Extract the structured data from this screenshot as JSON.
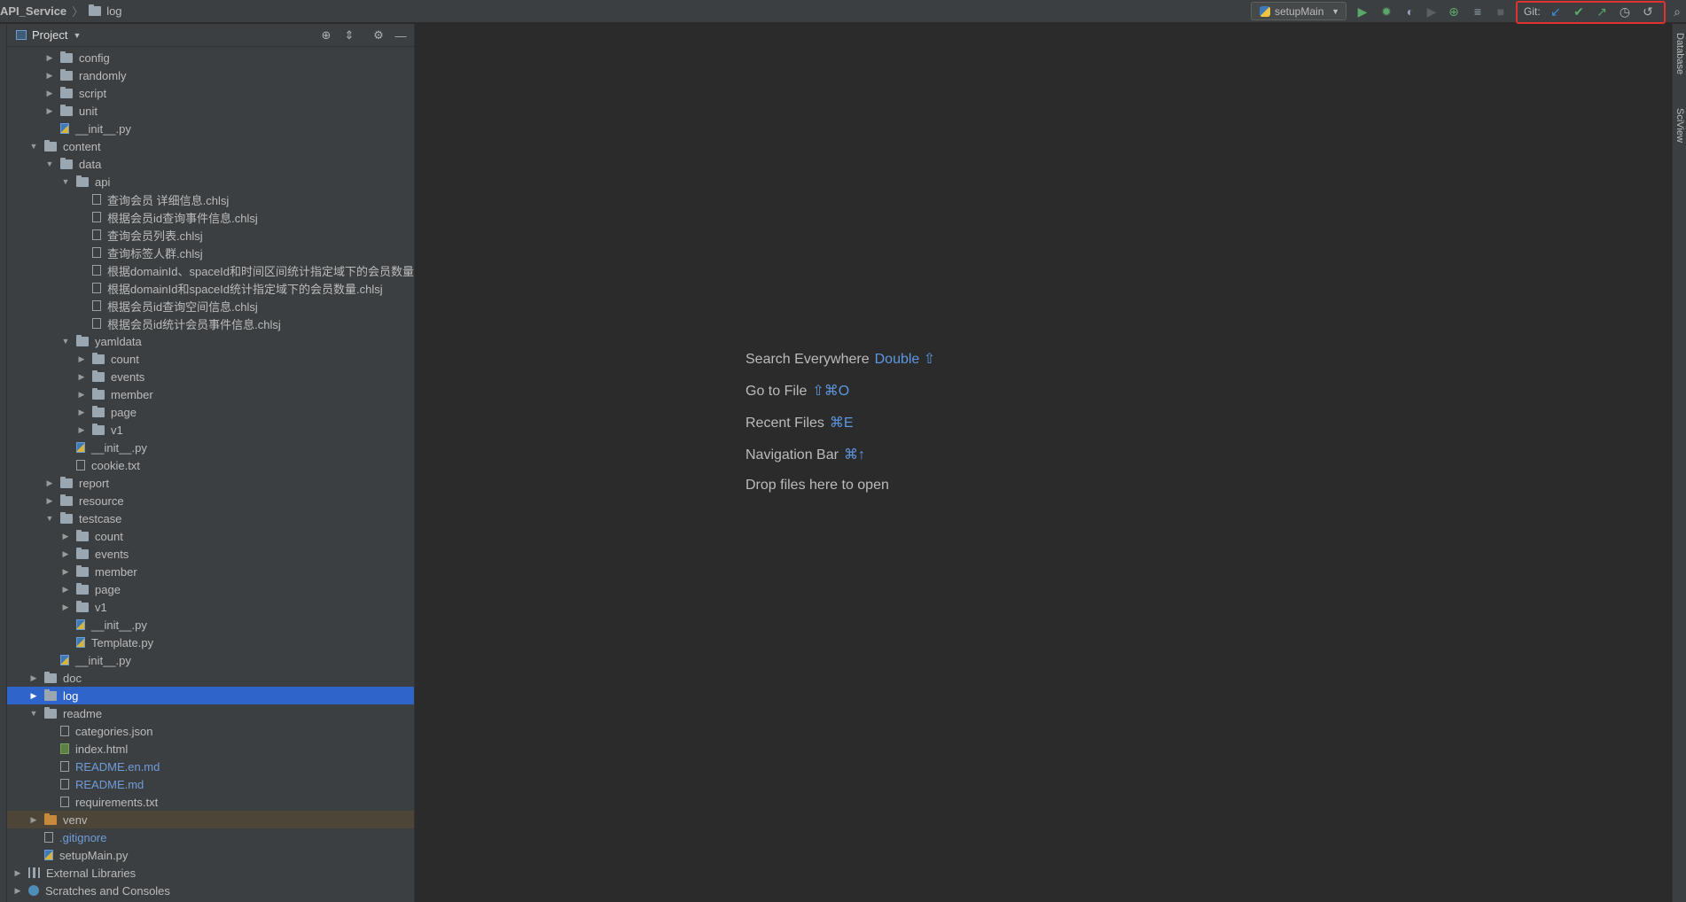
{
  "breadcrumb": {
    "project": "API_Service",
    "folder": "log"
  },
  "toolbar": {
    "run_config": "setupMain",
    "git_label": "Git:",
    "icons": [
      "run-icon",
      "debug-icon",
      "coverage-icon",
      "profile-icon",
      "attach-icon",
      "build-icon",
      "stop-icon"
    ],
    "git_icons": [
      "git-update-icon",
      "git-commit-icon",
      "git-push-icon",
      "git-history-icon",
      "git-rollback-icon"
    ],
    "search_icon": "search-icon"
  },
  "project_panel": {
    "title": "Project"
  },
  "tree": [
    {
      "depth": 2,
      "type": "folder",
      "expanded": false,
      "label": "config"
    },
    {
      "depth": 2,
      "type": "folder",
      "expanded": false,
      "label": "randomly"
    },
    {
      "depth": 2,
      "type": "folder",
      "expanded": false,
      "label": "script"
    },
    {
      "depth": 2,
      "type": "folder",
      "expanded": false,
      "label": "unit"
    },
    {
      "depth": 2,
      "type": "py",
      "label": "__init__.py"
    },
    {
      "depth": 1,
      "type": "folder",
      "expanded": true,
      "label": "content"
    },
    {
      "depth": 2,
      "type": "folder",
      "expanded": true,
      "label": "data"
    },
    {
      "depth": 3,
      "type": "folder",
      "expanded": true,
      "label": "api"
    },
    {
      "depth": 4,
      "type": "file",
      "label": " 查询会员 详细信息.chlsj"
    },
    {
      "depth": 4,
      "type": "file",
      "label": " 根据会员id查询事件信息.chlsj"
    },
    {
      "depth": 4,
      "type": "file",
      "label": "查询会员列表.chlsj"
    },
    {
      "depth": 4,
      "type": "file",
      "label": "查询标签人群.chlsj"
    },
    {
      "depth": 4,
      "type": "file",
      "label": "根据domainId、spaceId和时间区间统计指定域下的会员数量"
    },
    {
      "depth": 4,
      "type": "file",
      "label": "根据domainId和spaceId统计指定域下的会员数量.chlsj"
    },
    {
      "depth": 4,
      "type": "file",
      "label": "根据会员id查询空间信息.chlsj"
    },
    {
      "depth": 4,
      "type": "file",
      "label": "根据会员id统计会员事件信息.chlsj"
    },
    {
      "depth": 3,
      "type": "folder",
      "expanded": true,
      "label": "yamldata"
    },
    {
      "depth": 4,
      "type": "folder",
      "expanded": false,
      "label": "count"
    },
    {
      "depth": 4,
      "type": "folder",
      "expanded": false,
      "label": "events"
    },
    {
      "depth": 4,
      "type": "folder",
      "expanded": false,
      "label": "member"
    },
    {
      "depth": 4,
      "type": "folder",
      "expanded": false,
      "label": "page"
    },
    {
      "depth": 4,
      "type": "folder",
      "expanded": false,
      "label": "v1"
    },
    {
      "depth": 3,
      "type": "py",
      "label": "__init__.py"
    },
    {
      "depth": 3,
      "type": "file",
      "label": "cookie.txt"
    },
    {
      "depth": 2,
      "type": "folder",
      "expanded": false,
      "label": "report"
    },
    {
      "depth": 2,
      "type": "folder",
      "expanded": false,
      "label": "resource"
    },
    {
      "depth": 2,
      "type": "folder",
      "expanded": true,
      "label": "testcase"
    },
    {
      "depth": 3,
      "type": "folder",
      "expanded": false,
      "label": "count"
    },
    {
      "depth": 3,
      "type": "folder",
      "expanded": false,
      "label": "events"
    },
    {
      "depth": 3,
      "type": "folder",
      "expanded": false,
      "label": "member"
    },
    {
      "depth": 3,
      "type": "folder",
      "expanded": false,
      "label": "page"
    },
    {
      "depth": 3,
      "type": "folder",
      "expanded": false,
      "label": "v1"
    },
    {
      "depth": 3,
      "type": "py",
      "label": "__init__.py"
    },
    {
      "depth": 3,
      "type": "py",
      "label": "Template.py"
    },
    {
      "depth": 2,
      "type": "py",
      "label": "__init__.py"
    },
    {
      "depth": 1,
      "type": "folder",
      "expanded": false,
      "label": "doc"
    },
    {
      "depth": 1,
      "type": "folder",
      "expanded": false,
      "label": "log",
      "selected": true
    },
    {
      "depth": 1,
      "type": "folder",
      "expanded": true,
      "label": "readme"
    },
    {
      "depth": 2,
      "type": "json",
      "label": "categories.json"
    },
    {
      "depth": 2,
      "type": "html",
      "label": "index.html"
    },
    {
      "depth": 2,
      "type": "file",
      "label": "README.en.md",
      "color": "blue"
    },
    {
      "depth": 2,
      "type": "file",
      "label": "README.md",
      "color": "blue"
    },
    {
      "depth": 2,
      "type": "file",
      "label": "requirements.txt"
    },
    {
      "depth": 1,
      "type": "folder-orange",
      "expanded": false,
      "label": "venv",
      "venv": true
    },
    {
      "depth": 1,
      "type": "file",
      "label": ".gitignore",
      "color": "blue"
    },
    {
      "depth": 1,
      "type": "py",
      "label": "setupMain.py"
    },
    {
      "depth": 0,
      "type": "libs",
      "expanded": false,
      "label": "External Libraries"
    },
    {
      "depth": 0,
      "type": "scratch",
      "expanded": false,
      "label": "Scratches and Consoles"
    }
  ],
  "editor_hints": [
    {
      "label": "Search Everywhere",
      "key": "Double ⇧"
    },
    {
      "label": "Go to File",
      "key": "⇧⌘O"
    },
    {
      "label": "Recent Files",
      "key": "⌘E"
    },
    {
      "label": "Navigation Bar",
      "key": "⌘↑"
    },
    {
      "label": "Drop files here to open",
      "key": ""
    }
  ],
  "right_stripe": {
    "database": "Database",
    "sciview": "SciView"
  },
  "colors": {
    "selection": "#2f65ca",
    "git_highlight": "#e0322f",
    "shortcut_blue": "#5d97e0"
  }
}
